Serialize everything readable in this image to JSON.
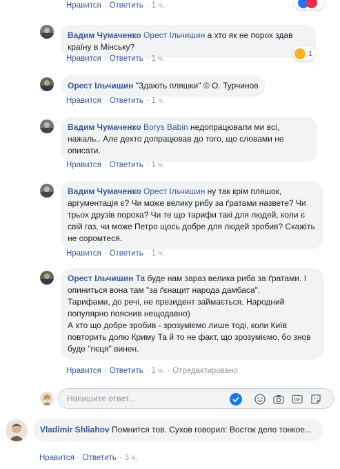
{
  "top_actions": {
    "like": "Нравится",
    "reply": "Ответить",
    "time": "1 ч."
  },
  "comments": [
    {
      "author": "Вадим Чумаченко",
      "tag": "Орест Ільчишин",
      "text": "а хто як не порох здав країну в Мінську?",
      "like": "Нравится",
      "reply": "Ответить",
      "time": "1 ч.",
      "reaction_count": "1"
    },
    {
      "author": "Орест Ільчишин",
      "text": "\"Здають пляшки\" © О. Турчинов",
      "like": "Нравится",
      "reply": "Ответить",
      "time": "1 ч."
    },
    {
      "author": "Вадим Чумаченко",
      "tag": "Borys Babin",
      "text": "недопрацювали ми всі, нажаль.. Але дехто допрацював до того, що словами не описати.",
      "like": "Нравится",
      "reply": "Ответить",
      "time": "1 ч."
    },
    {
      "author": "Вадим Чумаченко",
      "tag": "Орест Ільчишин",
      "text": "ну так крім пляшок, аргументація є? Чи може велику рибу за ґратами назвете? Чи трьох друзів пороха? Чи те що тарифи такі для людей, коли є свій газ, чи може Петро щось добре для людей зробив? Скажіть не соромтеся.",
      "like": "Нравится",
      "reply": "Ответить",
      "time": "1 ч."
    },
    {
      "author": "Орест Ільчишин",
      "text": "Та буде нам зараз велика риба за ґратами. І опиниться вона там \"за ґєнацит народа дамбаса\".",
      "text2": "Тарифами, до речі, не президент займається. Народний популярно пояснив нещодавно)",
      "text3": "А хто що добре зробив - зрозуміємо лише тоді, коли Київ повторить долю Криму Та й то не факт, що зрозуміємо, бо знов буде \"пєця\" винен.",
      "like": "Нравится",
      "reply": "Ответить",
      "time": "1 ч.",
      "edited": "Отредактировано"
    }
  ],
  "reply_box": {
    "placeholder": "Напишите ответ..."
  },
  "main_comment": {
    "author": "Vladimir Shliahov",
    "text": "Помнится тов. Сухов говорил: Восток дело тонкое...",
    "like": "Нравится",
    "reply": "Ответить",
    "time": "3 ч."
  },
  "colors": {
    "link": "#385898",
    "bubble": "#f2f3f5",
    "meta": "#90949c",
    "send": "#1877f2"
  }
}
